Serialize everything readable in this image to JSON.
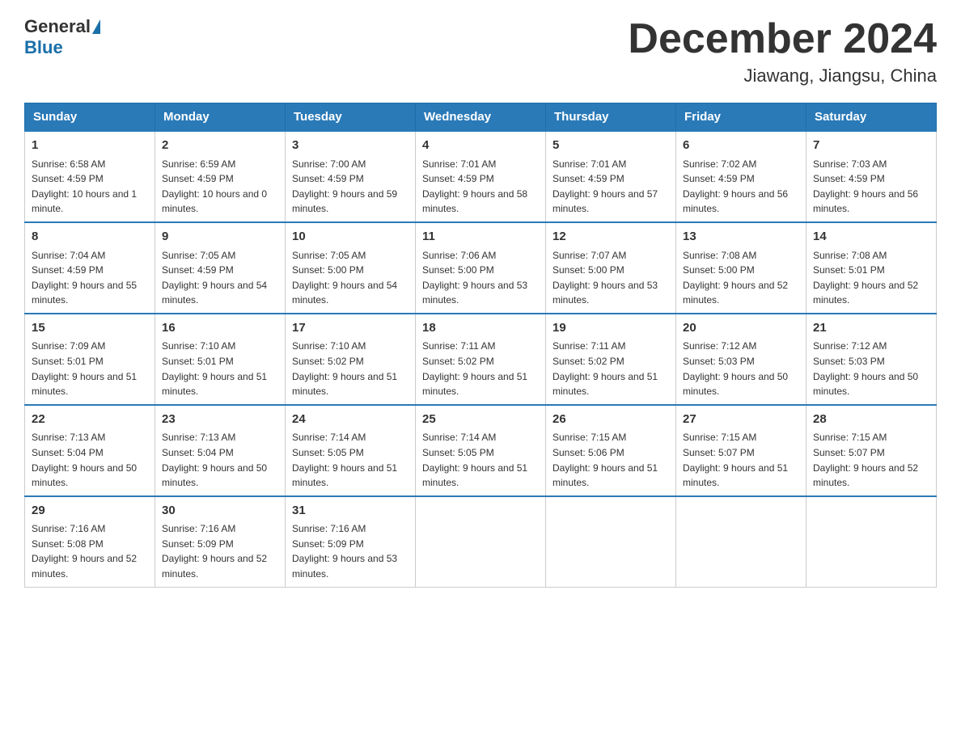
{
  "logo": {
    "general": "General",
    "blue": "Blue"
  },
  "title": "December 2024",
  "location": "Jiawang, Jiangsu, China",
  "weekdays": [
    "Sunday",
    "Monday",
    "Tuesday",
    "Wednesday",
    "Thursday",
    "Friday",
    "Saturday"
  ],
  "weeks": [
    [
      {
        "day": "1",
        "sunrise": "Sunrise: 6:58 AM",
        "sunset": "Sunset: 4:59 PM",
        "daylight": "Daylight: 10 hours and 1 minute."
      },
      {
        "day": "2",
        "sunrise": "Sunrise: 6:59 AM",
        "sunset": "Sunset: 4:59 PM",
        "daylight": "Daylight: 10 hours and 0 minutes."
      },
      {
        "day": "3",
        "sunrise": "Sunrise: 7:00 AM",
        "sunset": "Sunset: 4:59 PM",
        "daylight": "Daylight: 9 hours and 59 minutes."
      },
      {
        "day": "4",
        "sunrise": "Sunrise: 7:01 AM",
        "sunset": "Sunset: 4:59 PM",
        "daylight": "Daylight: 9 hours and 58 minutes."
      },
      {
        "day": "5",
        "sunrise": "Sunrise: 7:01 AM",
        "sunset": "Sunset: 4:59 PM",
        "daylight": "Daylight: 9 hours and 57 minutes."
      },
      {
        "day": "6",
        "sunrise": "Sunrise: 7:02 AM",
        "sunset": "Sunset: 4:59 PM",
        "daylight": "Daylight: 9 hours and 56 minutes."
      },
      {
        "day": "7",
        "sunrise": "Sunrise: 7:03 AM",
        "sunset": "Sunset: 4:59 PM",
        "daylight": "Daylight: 9 hours and 56 minutes."
      }
    ],
    [
      {
        "day": "8",
        "sunrise": "Sunrise: 7:04 AM",
        "sunset": "Sunset: 4:59 PM",
        "daylight": "Daylight: 9 hours and 55 minutes."
      },
      {
        "day": "9",
        "sunrise": "Sunrise: 7:05 AM",
        "sunset": "Sunset: 4:59 PM",
        "daylight": "Daylight: 9 hours and 54 minutes."
      },
      {
        "day": "10",
        "sunrise": "Sunrise: 7:05 AM",
        "sunset": "Sunset: 5:00 PM",
        "daylight": "Daylight: 9 hours and 54 minutes."
      },
      {
        "day": "11",
        "sunrise": "Sunrise: 7:06 AM",
        "sunset": "Sunset: 5:00 PM",
        "daylight": "Daylight: 9 hours and 53 minutes."
      },
      {
        "day": "12",
        "sunrise": "Sunrise: 7:07 AM",
        "sunset": "Sunset: 5:00 PM",
        "daylight": "Daylight: 9 hours and 53 minutes."
      },
      {
        "day": "13",
        "sunrise": "Sunrise: 7:08 AM",
        "sunset": "Sunset: 5:00 PM",
        "daylight": "Daylight: 9 hours and 52 minutes."
      },
      {
        "day": "14",
        "sunrise": "Sunrise: 7:08 AM",
        "sunset": "Sunset: 5:01 PM",
        "daylight": "Daylight: 9 hours and 52 minutes."
      }
    ],
    [
      {
        "day": "15",
        "sunrise": "Sunrise: 7:09 AM",
        "sunset": "Sunset: 5:01 PM",
        "daylight": "Daylight: 9 hours and 51 minutes."
      },
      {
        "day": "16",
        "sunrise": "Sunrise: 7:10 AM",
        "sunset": "Sunset: 5:01 PM",
        "daylight": "Daylight: 9 hours and 51 minutes."
      },
      {
        "day": "17",
        "sunrise": "Sunrise: 7:10 AM",
        "sunset": "Sunset: 5:02 PM",
        "daylight": "Daylight: 9 hours and 51 minutes."
      },
      {
        "day": "18",
        "sunrise": "Sunrise: 7:11 AM",
        "sunset": "Sunset: 5:02 PM",
        "daylight": "Daylight: 9 hours and 51 minutes."
      },
      {
        "day": "19",
        "sunrise": "Sunrise: 7:11 AM",
        "sunset": "Sunset: 5:02 PM",
        "daylight": "Daylight: 9 hours and 51 minutes."
      },
      {
        "day": "20",
        "sunrise": "Sunrise: 7:12 AM",
        "sunset": "Sunset: 5:03 PM",
        "daylight": "Daylight: 9 hours and 50 minutes."
      },
      {
        "day": "21",
        "sunrise": "Sunrise: 7:12 AM",
        "sunset": "Sunset: 5:03 PM",
        "daylight": "Daylight: 9 hours and 50 minutes."
      }
    ],
    [
      {
        "day": "22",
        "sunrise": "Sunrise: 7:13 AM",
        "sunset": "Sunset: 5:04 PM",
        "daylight": "Daylight: 9 hours and 50 minutes."
      },
      {
        "day": "23",
        "sunrise": "Sunrise: 7:13 AM",
        "sunset": "Sunset: 5:04 PM",
        "daylight": "Daylight: 9 hours and 50 minutes."
      },
      {
        "day": "24",
        "sunrise": "Sunrise: 7:14 AM",
        "sunset": "Sunset: 5:05 PM",
        "daylight": "Daylight: 9 hours and 51 minutes."
      },
      {
        "day": "25",
        "sunrise": "Sunrise: 7:14 AM",
        "sunset": "Sunset: 5:05 PM",
        "daylight": "Daylight: 9 hours and 51 minutes."
      },
      {
        "day": "26",
        "sunrise": "Sunrise: 7:15 AM",
        "sunset": "Sunset: 5:06 PM",
        "daylight": "Daylight: 9 hours and 51 minutes."
      },
      {
        "day": "27",
        "sunrise": "Sunrise: 7:15 AM",
        "sunset": "Sunset: 5:07 PM",
        "daylight": "Daylight: 9 hours and 51 minutes."
      },
      {
        "day": "28",
        "sunrise": "Sunrise: 7:15 AM",
        "sunset": "Sunset: 5:07 PM",
        "daylight": "Daylight: 9 hours and 52 minutes."
      }
    ],
    [
      {
        "day": "29",
        "sunrise": "Sunrise: 7:16 AM",
        "sunset": "Sunset: 5:08 PM",
        "daylight": "Daylight: 9 hours and 52 minutes."
      },
      {
        "day": "30",
        "sunrise": "Sunrise: 7:16 AM",
        "sunset": "Sunset: 5:09 PM",
        "daylight": "Daylight: 9 hours and 52 minutes."
      },
      {
        "day": "31",
        "sunrise": "Sunrise: 7:16 AM",
        "sunset": "Sunset: 5:09 PM",
        "daylight": "Daylight: 9 hours and 53 minutes."
      },
      null,
      null,
      null,
      null
    ]
  ]
}
